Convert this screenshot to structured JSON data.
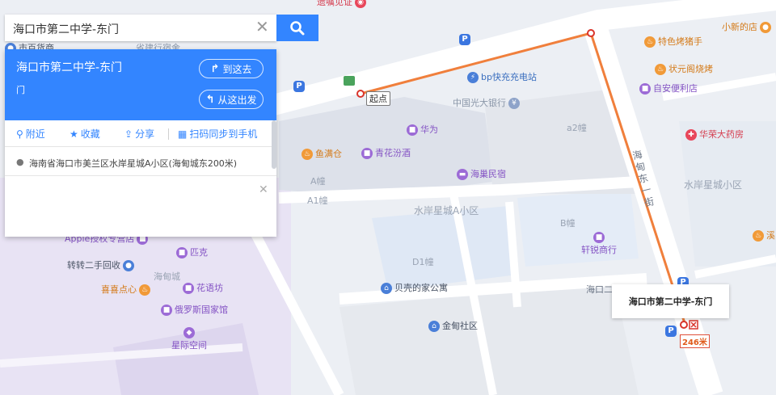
{
  "search": {
    "query": "海口市第二中学-东门",
    "clear_icon": "close-icon",
    "button_icon": "search-icon"
  },
  "panel": {
    "title": "海口市第二中学-东门",
    "subtitle": "门",
    "go_here_label": "到这去",
    "from_here_label": "从这出发",
    "tabs": [
      {
        "label": "附近",
        "icon": "location-icon"
      },
      {
        "label": "收藏",
        "icon": "star-icon"
      },
      {
        "label": "分享",
        "icon": "share-icon"
      },
      {
        "label": "扫码同步到手机",
        "icon": "qrcode-icon"
      }
    ],
    "address": "海南省海口市美兰区水岸星城A小区(海甸城东200米)"
  },
  "map": {
    "pois": [
      {
        "label": "遗嘱见证",
        "color": "#d53d4f"
      },
      {
        "label": "市百货商",
        "color": "#4b5566"
      },
      {
        "label": "省建行宿舍",
        "color": "#8a96a8"
      },
      {
        "label": "小新的店",
        "color": "#d47b1a"
      },
      {
        "label": "特色烤猪手",
        "color": "#d47b1a"
      },
      {
        "label": "状元阁烧烤",
        "color": "#d47b1a"
      },
      {
        "label": "自安便利店",
        "color": "#8453c4"
      },
      {
        "label": "华荣大药房",
        "color": "#d53d4f"
      },
      {
        "label": "bp快充充电站",
        "color": "#3b6fbf"
      },
      {
        "label": "中国光大银行",
        "color": "#8a96a8"
      },
      {
        "label": "华为",
        "color": "#8453c4"
      },
      {
        "label": "鱼满仓",
        "color": "#d47b1a"
      },
      {
        "label": "青花汾酒",
        "color": "#8453c4"
      },
      {
        "label": "海巢民宿",
        "color": "#8453c4"
      },
      {
        "label": "轩锐商行",
        "color": "#8453c4"
      },
      {
        "label": "贝壳的家公寓",
        "color": "#4b5566"
      },
      {
        "label": "金甸社区",
        "color": "#4b5566"
      },
      {
        "label": "Apple授权专营店",
        "color": "#8453c4"
      },
      {
        "label": "匹克",
        "color": "#8453c4"
      },
      {
        "label": "转转二手回收",
        "color": "#4b5566"
      },
      {
        "label": "喜喜点心",
        "color": "#d47b1a"
      },
      {
        "label": "花语坊",
        "color": "#8453c4"
      },
      {
        "label": "俄罗斯国家馆",
        "color": "#8453c4"
      },
      {
        "label": "星际空间",
        "color": "#8453c4"
      },
      {
        "label": "溪",
        "color": "#d47b1a"
      }
    ],
    "areas": [
      "a2幢",
      "A幢",
      "A1幢",
      "B幢",
      "D1幢",
      "水岸星城A小区",
      "水岸星城小区",
      "海甸城"
    ],
    "roads": [
      "海甸东一街",
      "海口二"
    ],
    "start_label": "起点",
    "destination_label": "海口市第二中学-东门",
    "distance_value": 246,
    "distance_unit": "米",
    "route_color": "#f07f3c"
  }
}
